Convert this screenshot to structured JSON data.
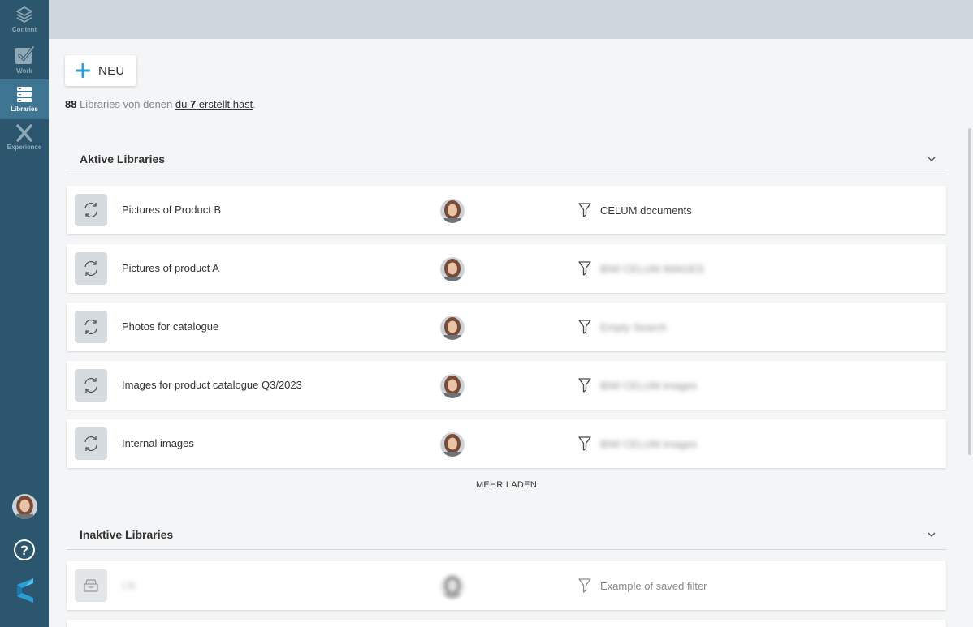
{
  "sidebar": {
    "items": [
      {
        "label": "Content",
        "icon": "layers-icon",
        "active": false
      },
      {
        "label": "Work",
        "icon": "checkbox-icon",
        "active": false
      },
      {
        "label": "Libraries",
        "icon": "libraries-icon",
        "active": true
      },
      {
        "label": "Experience",
        "icon": "experience-icon",
        "active": false
      }
    ],
    "help_label": "?"
  },
  "new_button": {
    "label": "NEU",
    "icon": "plus-icon"
  },
  "summary": {
    "count": "88",
    "text_before": " Libraries von denen ",
    "link_prefix": "du ",
    "link_count": "7",
    "link_suffix": " erstellt hast",
    "text_after": "."
  },
  "active_section": {
    "title": "Aktive Libraries",
    "rows": [
      {
        "name": "Pictures of Product B",
        "filter": "CELUM documents",
        "filter_blurred": false
      },
      {
        "name": "Pictures of product A",
        "filter": "BIW CELUM IMAGES",
        "filter_blurred": true
      },
      {
        "name": "Photos for catalogue",
        "filter": "Empty Search",
        "filter_blurred": true
      },
      {
        "name": "Images for product catalogue Q3/2023",
        "filter": "BIW CELUM images",
        "filter_blurred": true
      },
      {
        "name": "Internal images",
        "filter": "BIW CELUM images",
        "filter_blurred": true
      }
    ],
    "more_label": "MEHR LADEN"
  },
  "inactive_section": {
    "title": "Inaktive Libraries",
    "rows": [
      {
        "name": "Lib",
        "filter": "Example of saved filter"
      }
    ]
  },
  "colors": {
    "sidebar": "#2b566d",
    "sidebar_active": "#3d7593",
    "topbar": "#d1d7de",
    "accent": "#2a9fd6"
  }
}
